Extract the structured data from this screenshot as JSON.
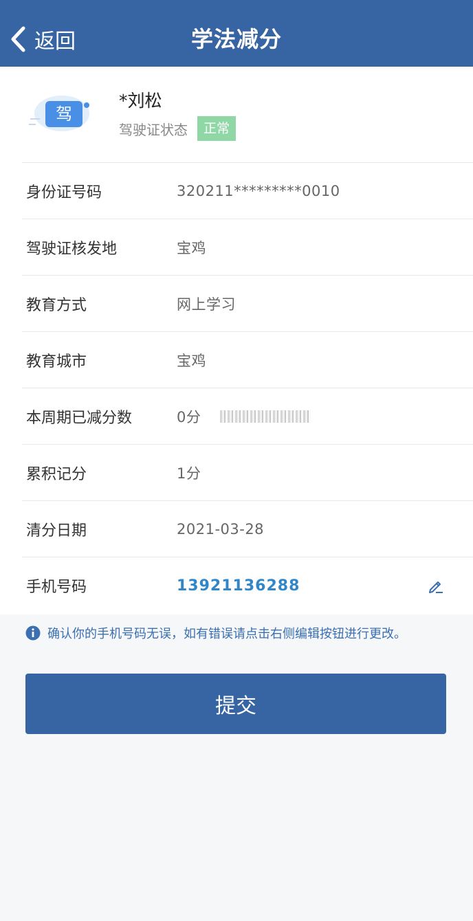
{
  "header": {
    "back_label": "返回",
    "title": "学法减分"
  },
  "profile": {
    "icon_char": "驾",
    "name": "*刘松",
    "status_label": "驾驶证状态",
    "status_badge": "正常",
    "status_color": "#8fd8a6"
  },
  "fields": [
    {
      "label": "身份证号码",
      "value": "320211*********0010"
    },
    {
      "label": "驾驶证核发地",
      "value": "宝鸡"
    },
    {
      "label": "教育方式",
      "value": "网上学习"
    },
    {
      "label": "教育城市",
      "value": "宝鸡"
    },
    {
      "label": "本周期已减分数",
      "value": "0分"
    },
    {
      "label": "累积记分",
      "value": "1分"
    },
    {
      "label": "清分日期",
      "value": "2021-03-28"
    },
    {
      "label": "手机号码",
      "value": "13921136288"
    }
  ],
  "notice": "确认你的手机号码无误，如有错误请点击右侧编辑按钮进行更改。",
  "submit_label": "提交",
  "colors": {
    "primary": "#3764a3",
    "link": "#2f86c9"
  }
}
